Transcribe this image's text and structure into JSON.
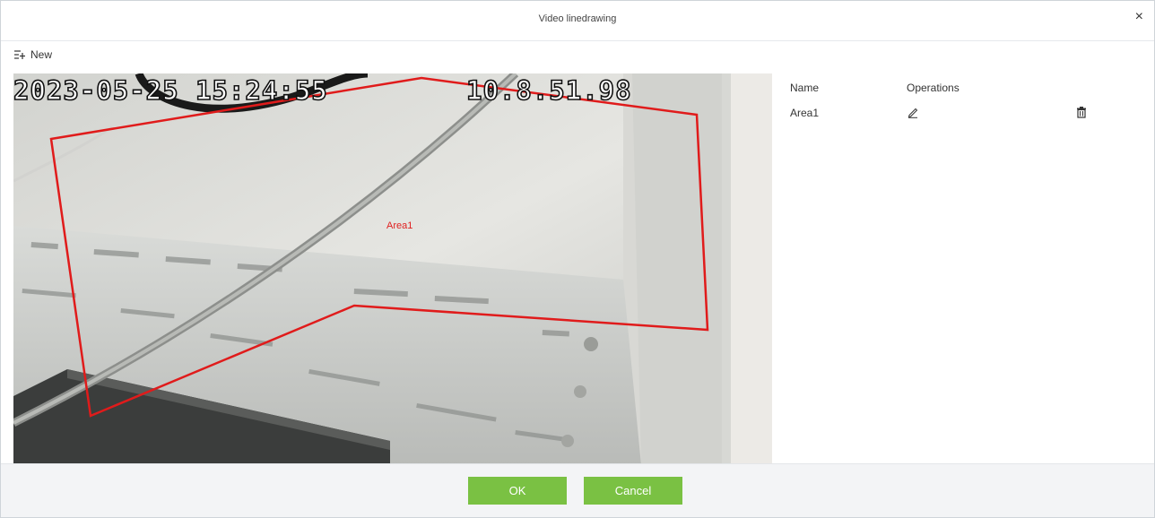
{
  "dialog": {
    "title": "Video linedrawing",
    "close_label": "×"
  },
  "toolbar": {
    "new_label": "New"
  },
  "video": {
    "osd_datetime": "2023-05-25 15:24:55",
    "osd_ip": "10.8.51.98",
    "area_label": "Area1",
    "polygon_color": "#e01b1b"
  },
  "areas_table": {
    "columns": [
      "Name",
      "Operations"
    ],
    "rows": [
      {
        "name": "Area1",
        "edit_icon": "pencil-icon",
        "delete_icon": "trash-icon"
      }
    ]
  },
  "footer": {
    "ok_label": "OK",
    "cancel_label": "Cancel",
    "button_color": "#7ac143"
  }
}
